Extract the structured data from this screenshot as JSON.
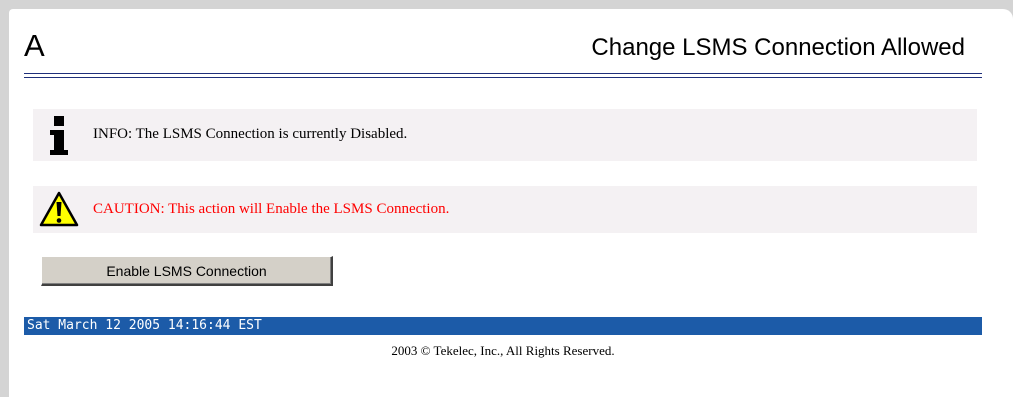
{
  "header": {
    "logo_text": "A",
    "title": "Change LSMS Connection Allowed"
  },
  "messages": {
    "info": {
      "icon": "info-icon",
      "text": "INFO: The LSMS Connection is currently Disabled."
    },
    "caution": {
      "icon": "warning-icon",
      "text": "CAUTION: This action will Enable the LSMS Connection.",
      "color": "#ff0000"
    }
  },
  "actions": {
    "enable_label": "Enable LSMS Connection"
  },
  "status_bar": {
    "datetime": "Sat March 12 2005 14:16:44 EST",
    "color": "#1c5ba8"
  },
  "footer": {
    "copyright": "2003 © Tekelec, Inc., All Rights Reserved."
  }
}
